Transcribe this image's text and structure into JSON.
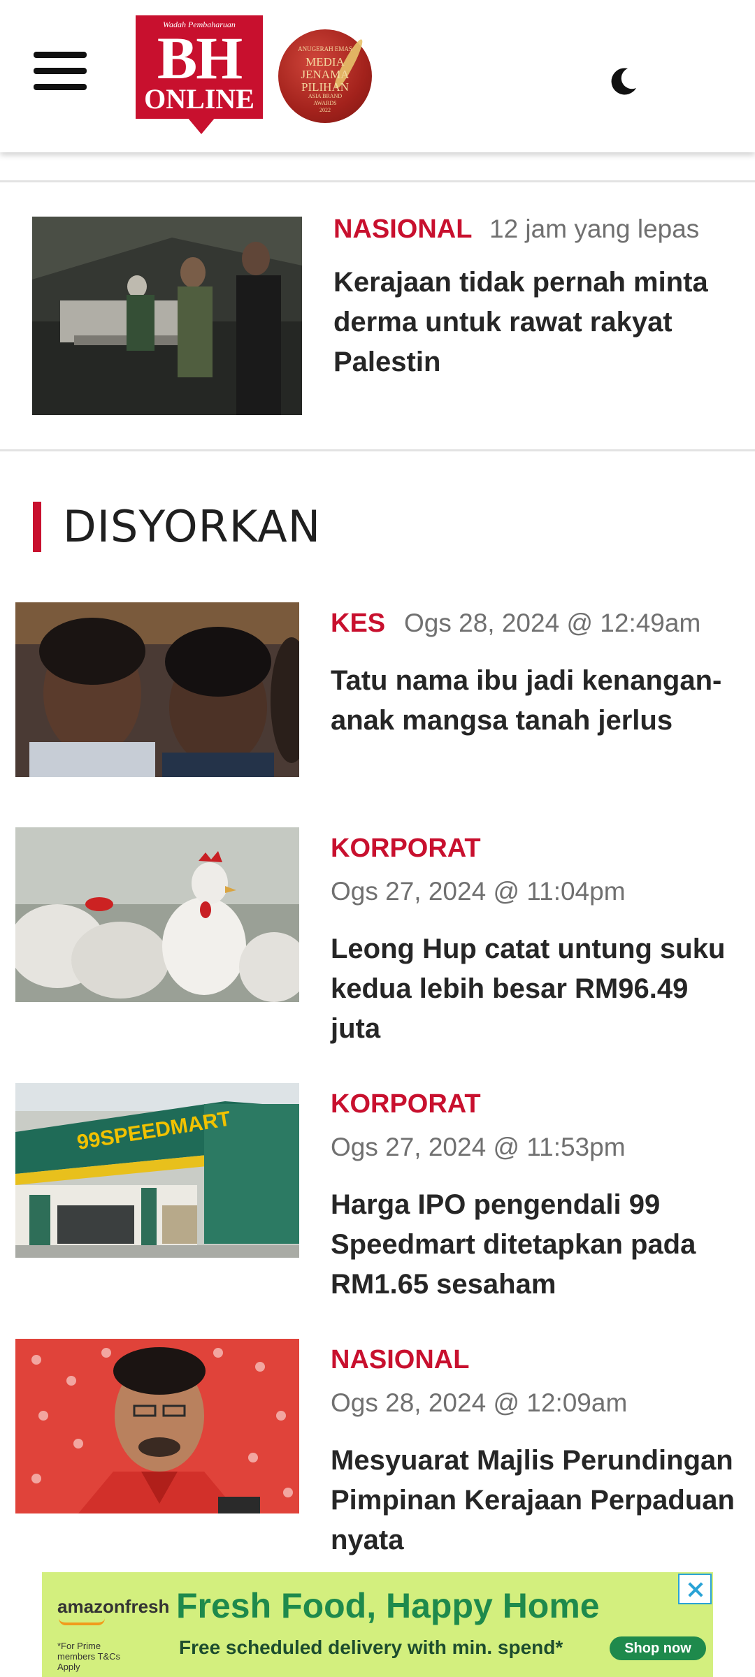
{
  "header": {
    "logo_tagline": "Wadah Pembaharuan",
    "logo_main": "BH",
    "logo_sub": "ONLINE",
    "award_lines": [
      "ANUGERAH EMAS",
      "MEDIA",
      "JENAMA",
      "PILIHAN",
      "ASIA BRAND",
      "AWARDS",
      "2022"
    ],
    "menu_icon": "hamburger-menu-icon",
    "theme_icon": "moon-icon"
  },
  "top_article": {
    "category": "NASIONAL",
    "time": "12 jam yang lepas",
    "title": "Kerajaan tidak pernah minta derma untuk rawat rakyat Palestin"
  },
  "section": {
    "title": "DISYORKAN"
  },
  "articles": [
    {
      "category": "KES",
      "time": "Ogs 28, 2024 @ 12:49am",
      "title": "Tatu nama ibu jadi kenangan-anak mangsa tanah jerlus"
    },
    {
      "category": "KORPORAT",
      "time": "Ogs 27, 2024 @ 11:04pm",
      "title": "Leong Hup catat untung suku kedua lebih besar RM96.49 juta"
    },
    {
      "category": "KORPORAT",
      "time": "Ogs 27, 2024 @ 11:53pm",
      "title": "Harga IPO pengendali 99 Speedmart ditetapkan pada RM1.65 sesaham"
    },
    {
      "category": "NASIONAL",
      "time": "Ogs 28, 2024 @ 12:09am",
      "title": "Mesyuarat Majlis Perundingan Pimpinan Kerajaan Perpaduan nyata"
    }
  ],
  "ad": {
    "brand": "amazonfresh",
    "headline": "Fresh Food, Happy Home",
    "sub": "Free scheduled delivery with min. spend*",
    "cta": "Shop now",
    "fine_print": "*For Prime members T&Cs Apply"
  },
  "colors": {
    "accent": "#c8102e",
    "text": "#262626",
    "meta": "#707070",
    "ad_background": "#d3ef7e"
  }
}
